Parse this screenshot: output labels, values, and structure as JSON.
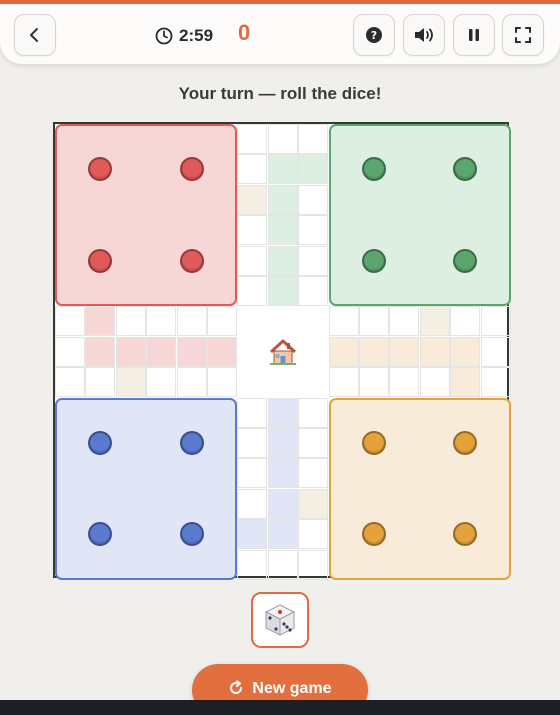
{
  "header": {
    "timer": "2:59",
    "score": "0",
    "icons": [
      "back-icon",
      "clock-icon",
      "help-icon",
      "volume-icon",
      "pause-icon",
      "fullscreen-icon"
    ]
  },
  "status": "Your turn — roll the dice!",
  "board": {
    "grid_size": 15,
    "colors": {
      "red": "#e05a5a",
      "green": "#5ba56e",
      "blue": "#5a7ad1",
      "yellow": "#e3a33a",
      "red_tint": "#f7d6d6",
      "green_tint": "#dcefe0",
      "blue_tint": "#e1e6f6",
      "yellow_tint": "#f8ebd9"
    },
    "players": [
      "red",
      "green",
      "blue",
      "yellow"
    ],
    "tokens_per_player": 4,
    "center_icon": "house-icon"
  },
  "dice": {
    "icon": "dice-icon"
  },
  "actions": {
    "new_game_label": "New game"
  }
}
